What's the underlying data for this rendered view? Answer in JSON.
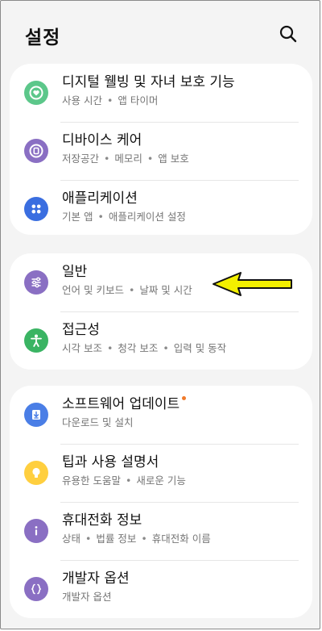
{
  "app_title": "설정",
  "icons": {
    "search": "search-icon"
  },
  "colors": {
    "green": "#5cc78a",
    "purple": "#8a6fc3",
    "blue": "#3a6ee0",
    "teal_green": "#3ab463",
    "doc_blue": "#4a7ee6",
    "yellow": "#ffcf3f",
    "arrow_yellow": "#f3f000",
    "update_dot": "#f07a2a"
  },
  "groups": [
    {
      "items": [
        {
          "title": "디지털 웰빙 및 자녀 보호 기능",
          "sub": [
            "사용 시간",
            "앱 타이머"
          ],
          "icon": "digital-wellbeing-icon"
        },
        {
          "title": "디바이스 케어",
          "sub": [
            "저장공간",
            "메모리",
            "앱 보호"
          ],
          "icon": "device-care-icon"
        },
        {
          "title": "애플리케이션",
          "sub": [
            "기본 앱",
            "애플리케이션 설정"
          ],
          "icon": "apps-icon"
        }
      ]
    },
    {
      "items": [
        {
          "title": "일반",
          "sub": [
            "언어 및 키보드",
            "날짜 및 시간"
          ],
          "icon": "general-management-icon"
        },
        {
          "title": "접근성",
          "sub": [
            "시각 보조",
            "청각 보조",
            "입력 및 동작"
          ],
          "icon": "accessibility-icon"
        }
      ]
    },
    {
      "items": [
        {
          "title": "소프트웨어 업데이트",
          "sub": [
            "다운로드 및 설치"
          ],
          "icon": "software-update-icon"
        },
        {
          "title": "팁과 사용 설명서",
          "sub": [
            "유용한 도움말",
            "새로운 기능"
          ],
          "icon": "tips-icon"
        },
        {
          "title": "휴대전화 정보",
          "sub": [
            "상태",
            "법률 정보",
            "휴대전화 이름"
          ],
          "icon": "phone-info-icon"
        },
        {
          "title": "개발자 옵션",
          "sub": [
            "개발자 옵션"
          ],
          "icon": "developer-options-icon"
        }
      ]
    }
  ]
}
